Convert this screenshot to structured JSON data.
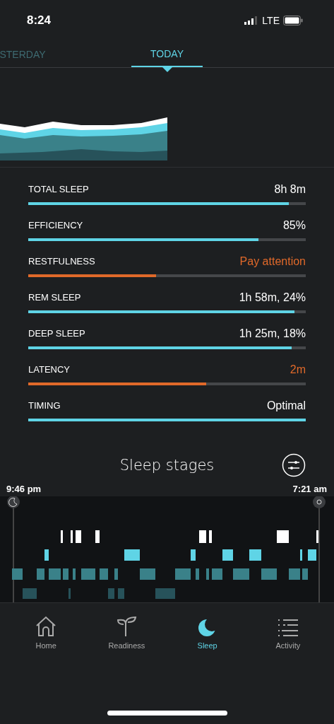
{
  "status_bar": {
    "time": "8:24",
    "network": "LTE"
  },
  "tabs": [
    {
      "label": "STERDAY",
      "selected": false
    },
    {
      "label": "TODAY",
      "selected": true
    }
  ],
  "contributors": [
    {
      "label": "TOTAL SLEEP",
      "value": "8h 8m",
      "level": 0.94,
      "color": "#5fd4e6"
    },
    {
      "label": "EFFICIENCY",
      "value": "85%",
      "level": 0.83,
      "color": "#5fd4e6"
    },
    {
      "label": "RESTFULNESS",
      "value": "Pay attention",
      "level": 0.46,
      "color": "#e0692a"
    },
    {
      "label": "REM SLEEP",
      "value": "1h 58m, 24%",
      "level": 0.96,
      "color": "#5fd4e6"
    },
    {
      "label": "DEEP SLEEP",
      "value": "1h 25m, 18%",
      "level": 0.95,
      "color": "#5fd4e6"
    },
    {
      "label": "LATENCY",
      "value": "2m",
      "level": 0.64,
      "color": "#e0692a"
    },
    {
      "label": "TIMING",
      "value": "Optimal",
      "level": 1,
      "color": "#5fd4e6"
    }
  ],
  "sleep_stages": {
    "title": "Sleep stages",
    "bedtime": "9:46 pm",
    "wake_time": "7:21 am"
  },
  "nav": [
    {
      "label": "Home",
      "selected": false
    },
    {
      "label": "Readiness",
      "selected": false
    },
    {
      "label": "Sleep",
      "selected": true
    },
    {
      "label": "Activity",
      "selected": false
    }
  ]
}
